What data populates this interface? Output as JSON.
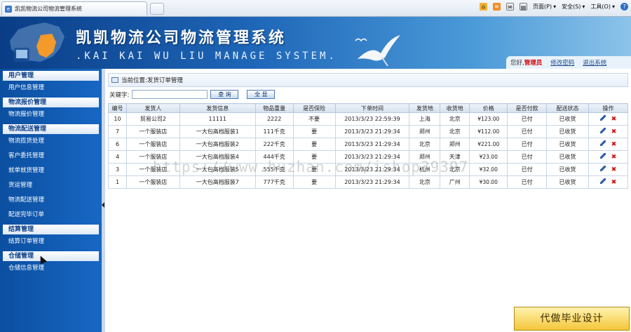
{
  "browser": {
    "tab_title": "凯凯物流公司物流管理系统",
    "commands": [
      "页面(P)",
      "安全(S)",
      "工具(O)"
    ]
  },
  "banner": {
    "title": "凯凯物流公司物流管理系统",
    "subtitle": ".KAI KAI WU LIU MANAGE SYSTEM.",
    "greeting": "您好,",
    "role": "管理员",
    "change_password": "修改密码",
    "logout": "退出系统"
  },
  "sidebar": {
    "sections": [
      {
        "title": "用户管理",
        "items": [
          "用户信息管理"
        ]
      },
      {
        "title": "物流报价管理",
        "items": [
          "物流报价管理"
        ]
      },
      {
        "title": "物流配送管理",
        "items": [
          "物流揽货处理",
          "客户委托管理",
          "就单就货管理",
          "货运管理",
          "物流配送管理",
          "配送完毕订单"
        ]
      },
      {
        "title": "结算管理",
        "items": [
          "结算订单管理"
        ]
      },
      {
        "title": "仓储管理",
        "items": [
          "仓储信息管理"
        ]
      }
    ]
  },
  "main": {
    "breadcrumb": "当前位置:发货订单管理",
    "search_label": "关键字:",
    "search_value": "",
    "search_button": "查 询",
    "all_button": "全 显",
    "columns": [
      "编号",
      "发货人",
      "发货信息",
      "物品重量",
      "是否保险",
      "下单时间",
      "发货地",
      "收货地",
      "价格",
      "是否付款",
      "配送状态",
      "操作"
    ],
    "rows": [
      {
        "id": "10",
        "sender": "贸易公司2",
        "info": "11111",
        "weight": "2222",
        "insured": "不要",
        "time": "2013/3/23 22:59:39",
        "from": "上海",
        "to": "北京",
        "price": "¥123.00",
        "paid": "已付",
        "status": "已收货"
      },
      {
        "id": "7",
        "sender": "一个服装店",
        "info": "一大包高档服装1",
        "weight": "111千克",
        "insured": "要",
        "time": "2013/3/23 21:29:34",
        "from": "郑州",
        "to": "北京",
        "price": "¥112.00",
        "paid": "已付",
        "status": "已收货"
      },
      {
        "id": "6",
        "sender": "一个服装店",
        "info": "一大包高档服装2",
        "weight": "222千克",
        "insured": "要",
        "time": "2013/3/23 21:29:34",
        "from": "北京",
        "to": "郑州",
        "price": "¥221.00",
        "paid": "已付",
        "status": "已收货"
      },
      {
        "id": "4",
        "sender": "一个服装店",
        "info": "一大包高档服装4",
        "weight": "444千克",
        "insured": "要",
        "time": "2013/3/23 21:29:34",
        "from": "郑州",
        "to": "天津",
        "price": "¥23.00",
        "paid": "已付",
        "status": "已收货"
      },
      {
        "id": "3",
        "sender": "一个服装店",
        "info": "一大包高档服装5",
        "weight": "555千克",
        "insured": "要",
        "time": "2013/3/23 21:29:34",
        "from": "杭州",
        "to": "北京",
        "price": "¥32.00",
        "paid": "已付",
        "status": "已收货"
      },
      {
        "id": "1",
        "sender": "一个服装店",
        "info": "一大包高档服装7",
        "weight": "777千克",
        "insured": "要",
        "time": "2013/3/23 21:29:34",
        "from": "北京",
        "to": "广州",
        "price": "¥30.00",
        "paid": "已付",
        "status": "已收货"
      }
    ]
  },
  "watermark": "https://www.huzhan.com/ishop39397",
  "ad_badge": "代做毕业设计",
  "colors": {
    "paid": "#0a8c10",
    "role": "#d00000",
    "sidebar": "#1767c4"
  }
}
